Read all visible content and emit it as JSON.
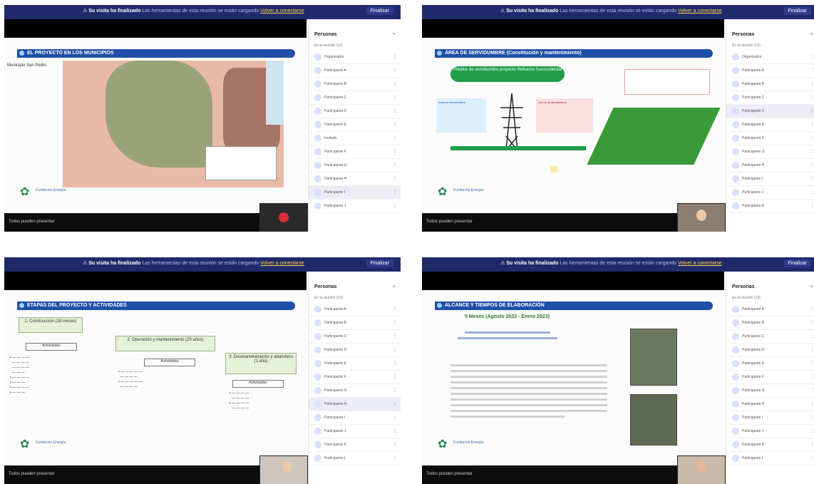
{
  "common": {
    "warning_title": "Su visita ha finalizado",
    "warning_text": "Las herramientas de esta reunión se están cargando",
    "warning_link": "Volver a conectarse",
    "finish_label": "Finalizar",
    "panel_title": "Personas",
    "panel_close": "×",
    "bottom_label": "Todos pueden presentar",
    "logo_text": "Fundación Energía",
    "end_icon": "end-call-icon"
  },
  "frames": [
    {
      "slide_title": "EL PROYECTO EN LOS MUNICIPIOS",
      "map_label": "Municipio San Pedro",
      "panel_sub": "En la reunión (12)",
      "participants": [
        "Organizador",
        "Participante A",
        "Participante B",
        "Participante C",
        "Participante D",
        "Participante E",
        "Invitado",
        "Participante F",
        "Participante G",
        "Participante H",
        "Participante I",
        "Participante J"
      ]
    },
    {
      "slide_title": "ÁREA DE SERVIDUMBRE (Constitución y mantenimiento)",
      "green_button": "Predios de servidumbre proyecto Refuerzo Suroccidental",
      "box_left": "Zona de servidumbre",
      "box_right": "Uso de la servidumbre",
      "panel_sub": "En la reunión (13)",
      "participants": [
        "Organizador",
        "Participante A",
        "Participante B",
        "Participante C",
        "Participante D",
        "Participante E",
        "Participante F",
        "Participante G",
        "Participante H",
        "Participante I",
        "Participante J",
        "Participante K"
      ]
    },
    {
      "slide_title": "ETAPAS DEL PROYECTO Y ACTIVIDADES",
      "stage1": "1. Construcción (18 meses)",
      "stage2": "2. Operación y mantenimiento (25 años)",
      "stage3": "3. Desmantelamiento y abandono (1 año)",
      "act_label": "Actividades",
      "panel_sub": "En la reunión (13)",
      "participants": [
        "Participante A",
        "Participante B",
        "Participante C",
        "Participante D",
        "Participante E",
        "Participante F",
        "Participante G",
        "Participante H",
        "Participante I",
        "Participante J",
        "Participante K",
        "Participante L"
      ]
    },
    {
      "slide_title": "ALCANCE Y TIEMPOS DE ELABORACIÓN",
      "subtitle": "5 Meses (Agosto 2022 - Enero 2023)",
      "panel_sub": "En la reunión (13)",
      "participants": [
        "Participante A",
        "Participante B",
        "Participante C",
        "Participante D",
        "Participante E",
        "Participante F",
        "Participante G",
        "Participante H",
        "Participante I",
        "Participante J",
        "Participante K",
        "Participante L"
      ]
    }
  ]
}
